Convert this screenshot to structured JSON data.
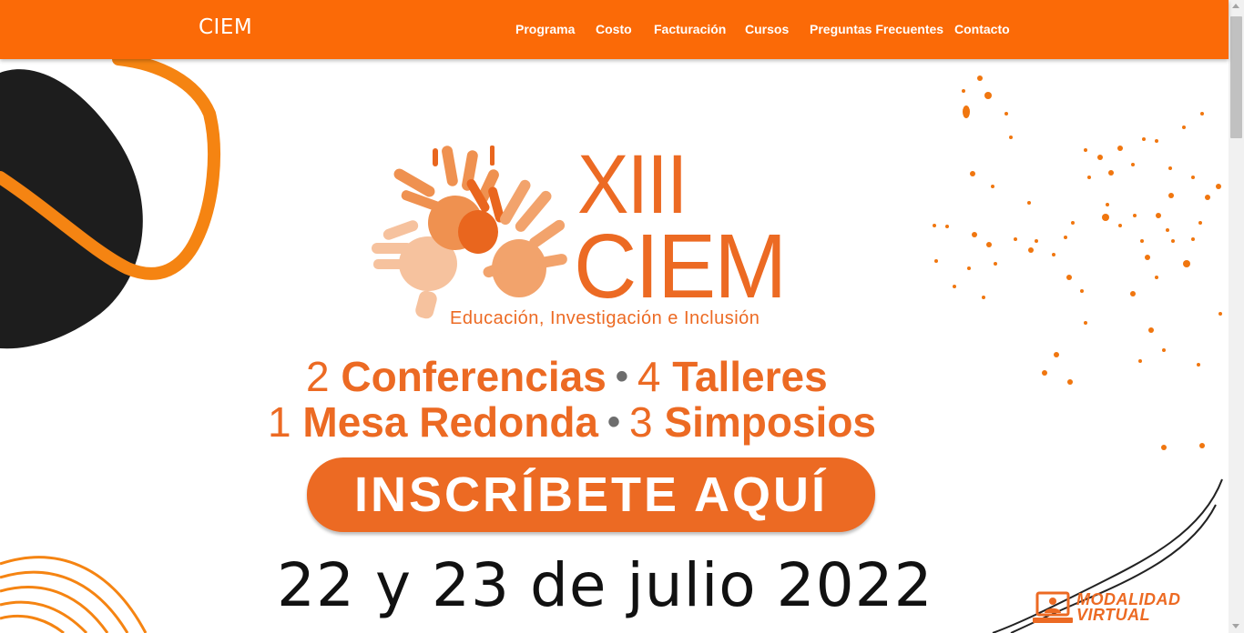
{
  "navbar": {
    "brand": "CIEM",
    "items": [
      {
        "label": "Programa"
      },
      {
        "label": "Costo"
      },
      {
        "label": "Facturación"
      },
      {
        "label": "Cursos"
      },
      {
        "label": "Preguntas Frecuentes"
      },
      {
        "label": "Contacto"
      }
    ]
  },
  "hero": {
    "logo": {
      "numeral": "XIII",
      "name": "CIEM",
      "tagline": "Educación, Investigación e Inclusión"
    },
    "stats_line1": {
      "n1": "2",
      "t1": "Conferencias",
      "n2": "4",
      "t2": "Talleres"
    },
    "stats_line2": {
      "n1": "1",
      "t1": "Mesa Redonda",
      "n2": "3",
      "t2": "Simposios"
    },
    "separator": "•",
    "cta_label": "INSCRÍBETE AQUÍ",
    "date": "22 y 23 de julio 2022",
    "modality_line1": "MODALIDAD",
    "modality_line2": "VIRTUAL"
  },
  "colors": {
    "navbar": "#fb6a07",
    "accent": "#ec6a23",
    "dark_shape": "#1d1d1d"
  },
  "icons": [
    "hands-logo-icon",
    "computer-user-icon"
  ]
}
